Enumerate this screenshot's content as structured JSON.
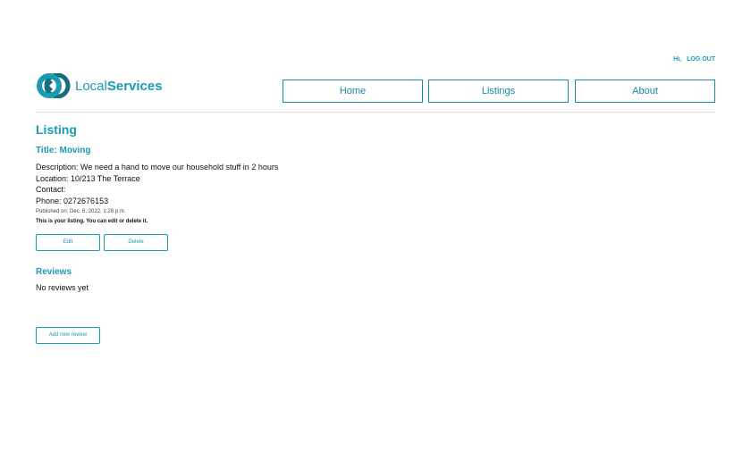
{
  "header": {
    "greeting": "Hi,",
    "logout": "LOG OUT",
    "logo_a": "Local",
    "logo_b": "Services",
    "nav": [
      "Home",
      "Listings",
      "About"
    ]
  },
  "listing": {
    "heading": "Listing",
    "title": "Title: Moving",
    "description": "Description: We need a hand to move our household stuff in 2 hours",
    "location": "Location: 10/213 The Terrace",
    "contact": "Contact:",
    "phone": "Phone: 0272676153",
    "published": "Published on: Dec. 6, 2022, 1:28 p.m.",
    "owner_note": "This is your listing. You can edit or delete it.",
    "edit": "Edit",
    "delete": "Delete"
  },
  "reviews": {
    "heading": "Reviews",
    "empty": "No reviews yet",
    "add": "Add new review"
  }
}
